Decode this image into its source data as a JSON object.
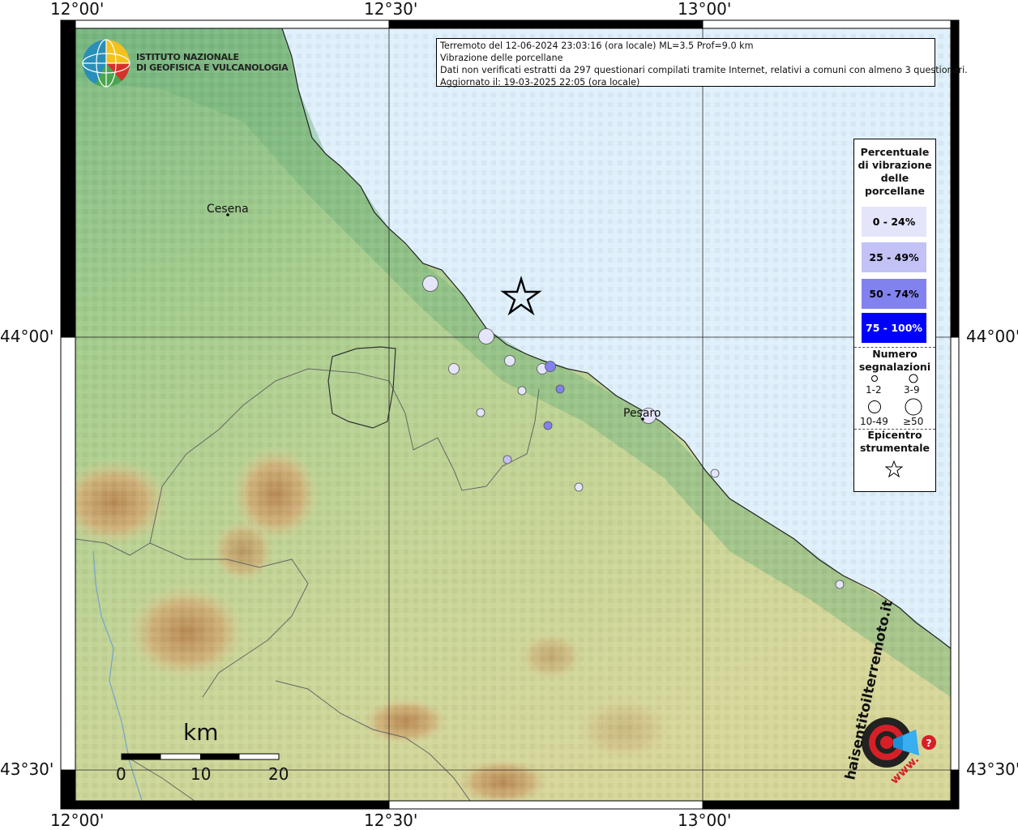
{
  "coords": {
    "lon_top": [
      "12°00'",
      "12°30'",
      "13°00'"
    ],
    "lon_bottom": [
      "12°00'",
      "12°30'",
      "13°00'"
    ],
    "lat_left": [
      "44°00'",
      "43°30'"
    ],
    "lat_right": [
      "44°00'",
      "43°30'"
    ]
  },
  "info": {
    "line1": "Terremoto del 12-06-2024 23:03:16 (ora locale) ML=3.5 Prof=9.0 km",
    "line2": "Vibrazione delle porcellane",
    "line3": "Dati non verificati estratti da 297 questionari compilati tramite Internet, relativi a comuni con almeno 3 questionari.",
    "line4": "Aggiornato il: 19-03-2025 22:05 (ora locale)"
  },
  "logo": {
    "line1": "ISTITUTO NAZIONALE",
    "line2": "DI GEOFISICA E VULCANOLOGIA"
  },
  "legend": {
    "title": [
      "Percentuale",
      "di vibrazione",
      "delle",
      "porcellane"
    ],
    "classes": [
      {
        "label": "0 - 24%",
        "color": "#e4e4fb",
        "text_color": "#000000"
      },
      {
        "label": "25 - 49%",
        "color": "#c2c2f7",
        "text_color": "#000000"
      },
      {
        "label": "50 - 74%",
        "color": "#8282ee",
        "text_color": "#000000"
      },
      {
        "label": "75 - 100%",
        "color": "#0000ff",
        "text_color": "#ffffff"
      }
    ],
    "count_title": [
      "Numero",
      "segnalazioni"
    ],
    "counts": [
      "1-2",
      "3-9",
      "10-49",
      "≥50"
    ],
    "epicenter_title": [
      "Epicentro",
      "strumentale"
    ]
  },
  "cities": [
    {
      "name": "Cesena"
    },
    {
      "name": "Pesaro"
    }
  ],
  "scale": {
    "unit": "km",
    "labels": [
      "0",
      "10",
      "20"
    ]
  },
  "watermark": {
    "text": "haisentitoilterremoto.it",
    "prefix": "www."
  },
  "colors": {
    "sea": "#dff0fc",
    "land_low": "#8fc48e",
    "land_mid": "#c9d796",
    "mountain": "#c7a26b"
  }
}
